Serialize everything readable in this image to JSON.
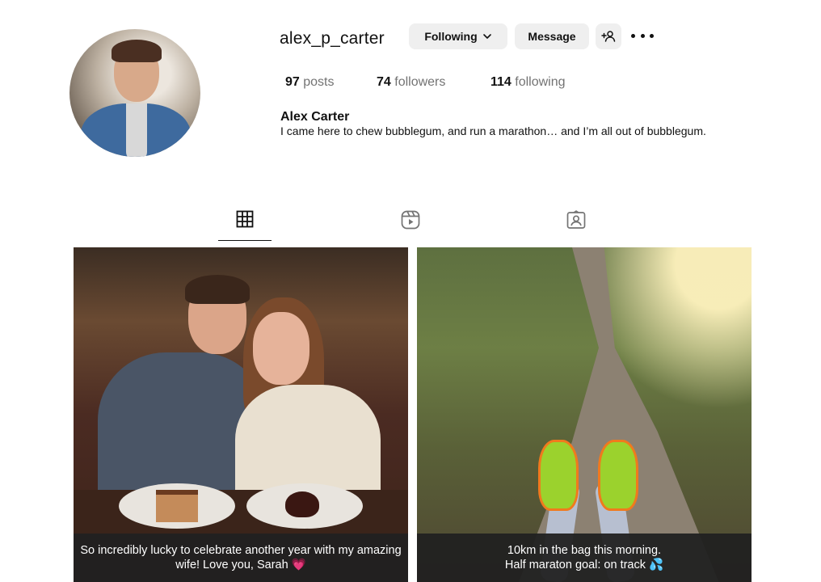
{
  "profile": {
    "username": "alex_p_carter",
    "full_name": "Alex Carter",
    "bio": "I came here to chew bubblegum, and run a marathon… and I’m all out of bubblegum."
  },
  "actions": {
    "following_label": "Following",
    "message_label": "Message"
  },
  "stats": {
    "posts_count": "97",
    "posts_label": "posts",
    "followers_count": "74",
    "followers_label": "followers",
    "following_count": "114",
    "following_label": "following"
  },
  "tabs": [
    {
      "icon": "grid-icon",
      "active": true
    },
    {
      "icon": "reels-icon",
      "active": false
    },
    {
      "icon": "tagged-icon",
      "active": false
    }
  ],
  "posts": [
    {
      "caption": "So incredibly lucky to celebrate another year with my amazing\nwife! Love you, Sarah 💗"
    },
    {
      "caption": "10km in the bag this morning.\nHalf maraton goal: on track 💦"
    }
  ],
  "colors": {
    "button_bg": "#efefef",
    "muted_text": "#737373",
    "caption_bg": "#212121"
  }
}
